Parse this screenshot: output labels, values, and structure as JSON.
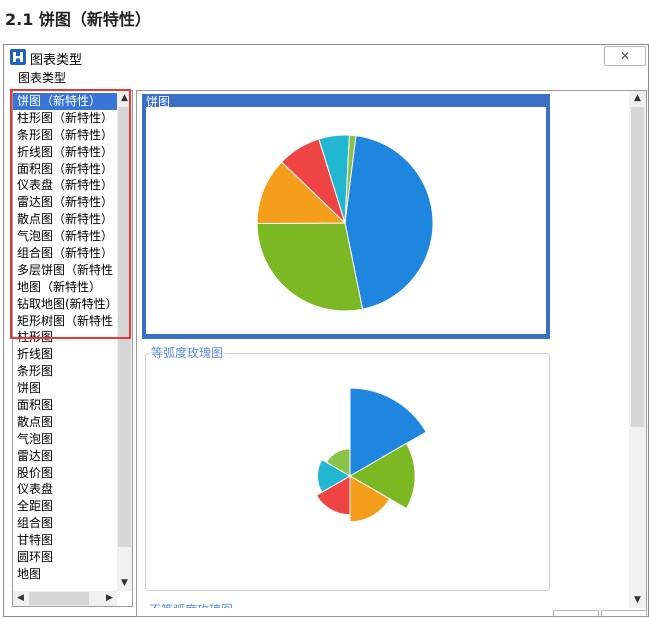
{
  "section_heading": "2.1 饼图（新特性）",
  "dialog": {
    "title": "图表类型",
    "close_symbol": "✕"
  },
  "chart_type_group_label": "图表类型",
  "list_items": [
    "饼图（新特性）",
    "柱形图（新特性）",
    "条形图（新特性）",
    "折线图（新特性）",
    "面积图（新特性）",
    "仪表盘（新特性）",
    "雷达图（新特性）",
    "散点图（新特性）",
    "气泡图（新特性）",
    "组合图（新特性）",
    "多层饼图（新特性",
    "地图（新特性）",
    "钻取地图(新特性）",
    "矩形树图（新特性",
    "柱形图",
    "折线图",
    "条形图",
    "饼图",
    "面积图",
    "散点图",
    "气泡图",
    "雷达图",
    "股价图",
    "仪表盘",
    "全距图",
    "组合图",
    "甘特图",
    "圆环图",
    "地图"
  ],
  "selected_index": 0,
  "preview_cards": [
    {
      "label": "饼图"
    },
    {
      "label": "等弧度玫瑰图"
    },
    {
      "label": "不等弧度玫瑰图"
    }
  ],
  "pie_preview": {
    "slices": [
      {
        "share": 0.468,
        "color": "#1f86e0"
      },
      {
        "share": 0.281,
        "color": "#7cb823"
      },
      {
        "share": 0.123,
        "color": "#f59e1b"
      },
      {
        "share": 0.08,
        "color": "#ef4444"
      },
      {
        "share": 0.056,
        "color": "#22b7d1"
      },
      {
        "share": 0.012,
        "color": "#8bc34a"
      }
    ]
  },
  "rose_preview": {
    "sectors": [
      {
        "value": 1.0,
        "color": "#1f86e0"
      },
      {
        "value": 0.74,
        "color": "#7cb823"
      },
      {
        "value": 0.52,
        "color": "#f59e1b"
      },
      {
        "value": 0.44,
        "color": "#ef4444"
      },
      {
        "value": 0.37,
        "color": "#22b7d1"
      },
      {
        "value": 0.31,
        "color": "#8bc34a"
      }
    ]
  },
  "colors": {
    "selection": "#3875d7",
    "highlight_border": "#e53935",
    "card_frame": "#3a6fc6"
  },
  "icons": {
    "app": "app-logo-icon",
    "close": "close-icon",
    "scroll_up": "chevron-up-icon",
    "scroll_down": "chevron-down-icon",
    "scroll_left": "chevron-left-icon",
    "scroll_right": "chevron-right-icon"
  }
}
